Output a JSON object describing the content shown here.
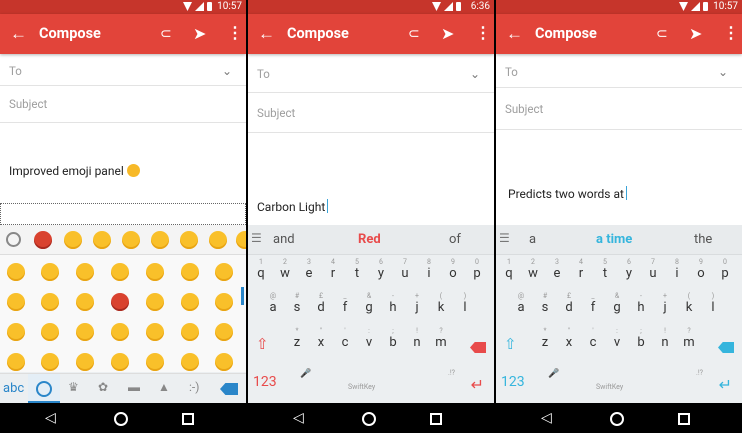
{
  "status_times": [
    "10:57",
    "6:36",
    "10:57"
  ],
  "appbar": {
    "title": "Compose",
    "back_glyph": "←",
    "attach_glyph": "⊂",
    "send_glyph": "➤",
    "more_glyph": "⋮"
  },
  "fields": {
    "to_label": "To",
    "subject_label": "Subject",
    "chevron": "⌄"
  },
  "panels": [
    {
      "body": "Improved emoji panel"
    },
    {
      "body": "Carbon Light",
      "predictions": [
        "and",
        "Red",
        "of"
      ],
      "accent": "#e84b4b"
    },
    {
      "body": "Predicts two words at",
      "predictions": [
        "a",
        "a time",
        "the"
      ],
      "accent": "#35b5dd"
    }
  ],
  "emoji_keyboard": {
    "mode_label": "abc"
  },
  "keyboard": {
    "row1": [
      "q",
      "w",
      "e",
      "r",
      "t",
      "y",
      "u",
      "i",
      "o",
      "p"
    ],
    "row1_alt": [
      "1",
      "2",
      "3",
      "4",
      "5",
      "6",
      "7",
      "8",
      "9",
      "0"
    ],
    "row2": [
      "a",
      "s",
      "d",
      "f",
      "g",
      "h",
      "j",
      "k",
      "l"
    ],
    "row2_alt": [
      "@",
      "#",
      "£",
      "_",
      "&",
      "-",
      "+",
      "(",
      ")"
    ],
    "row3": [
      "z",
      "x",
      "c",
      "v",
      "b",
      "n",
      "m"
    ],
    "row3_alt": [
      "*",
      "\"",
      "'",
      ":",
      ";",
      "!",
      "?"
    ],
    "num_label": "123",
    "brand_label": "SwiftKey",
    "mic_glyph": "🎤",
    "punct_top": ".!?",
    "shift_glyph": "⇧",
    "enter_glyph": "↵"
  },
  "navbar": {
    "back_glyph": "◁"
  }
}
